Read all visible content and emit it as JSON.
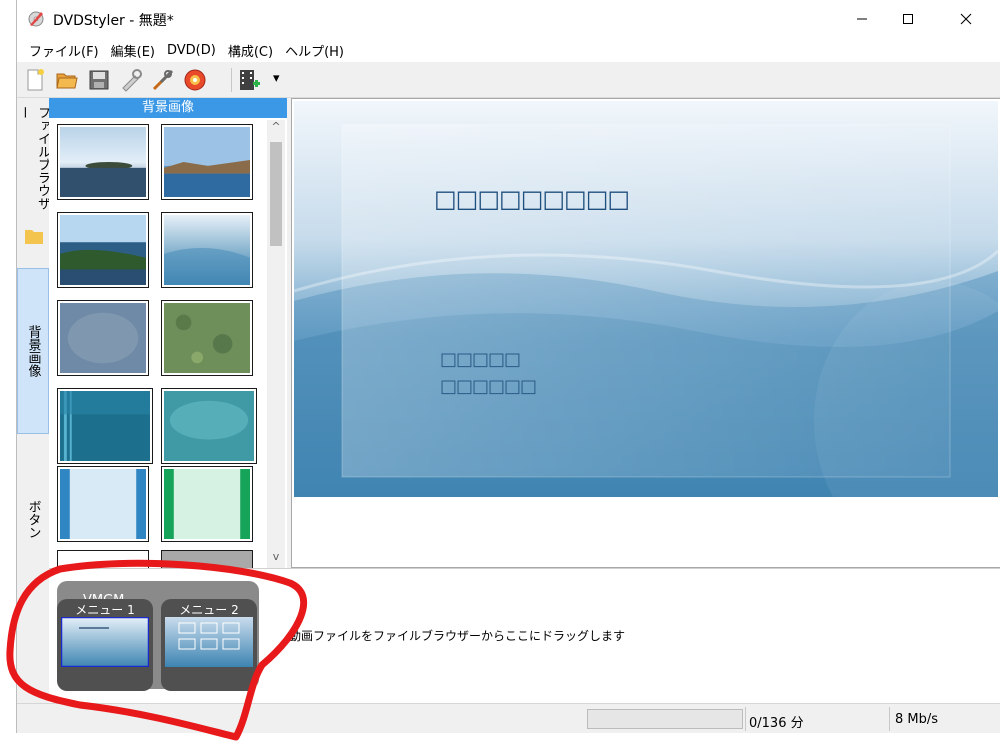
{
  "window": {
    "title": "DVDStyler - 無題*",
    "minimize_symbol": "—",
    "maximize_symbol": "☐",
    "close_symbol": "✕"
  },
  "menu": [
    "ファイル(F)",
    "編集(E)",
    "DVD(D)",
    "構成(C)",
    "ヘルプ(H)"
  ],
  "toolbar": {
    "icons": [
      "new-file-icon",
      "open-folder-icon",
      "save-icon",
      "properties-icon",
      "settings-icon",
      "burn-disc-icon",
      "add-video-icon",
      "dropdown-arrow-icon"
    ],
    "dropdown_arrow": "▾"
  },
  "sidebar_tabs": [
    {
      "label": "ファイルブラウザー",
      "icon": "folder-icon"
    },
    {
      "label": "背景画像",
      "active": true
    },
    {
      "label": "ボタン"
    }
  ],
  "backgrounds_panel": {
    "header": "背景画像",
    "scroll_up": "^",
    "scroll_down": "v"
  },
  "preview": {
    "title_placeholder": "□□□□□□□□□",
    "line1": "□□□□□",
    "line2": "□□□□□□"
  },
  "titleset": {
    "vmgm_label": "VMGM",
    "menus": [
      {
        "label": "メニュー 1",
        "selected": true
      },
      {
        "label": "メニュー 2",
        "selected": false
      }
    ],
    "drag_hint": "動画ファイルをファイルブラウザーからここにドラッグします"
  },
  "status": {
    "duration": "0/136 分",
    "bitrate": "8 Mb/s"
  },
  "colors": {
    "accent": "#3b98e6",
    "annotation": "#e8191a",
    "preview_blue": "#3f86b3"
  }
}
